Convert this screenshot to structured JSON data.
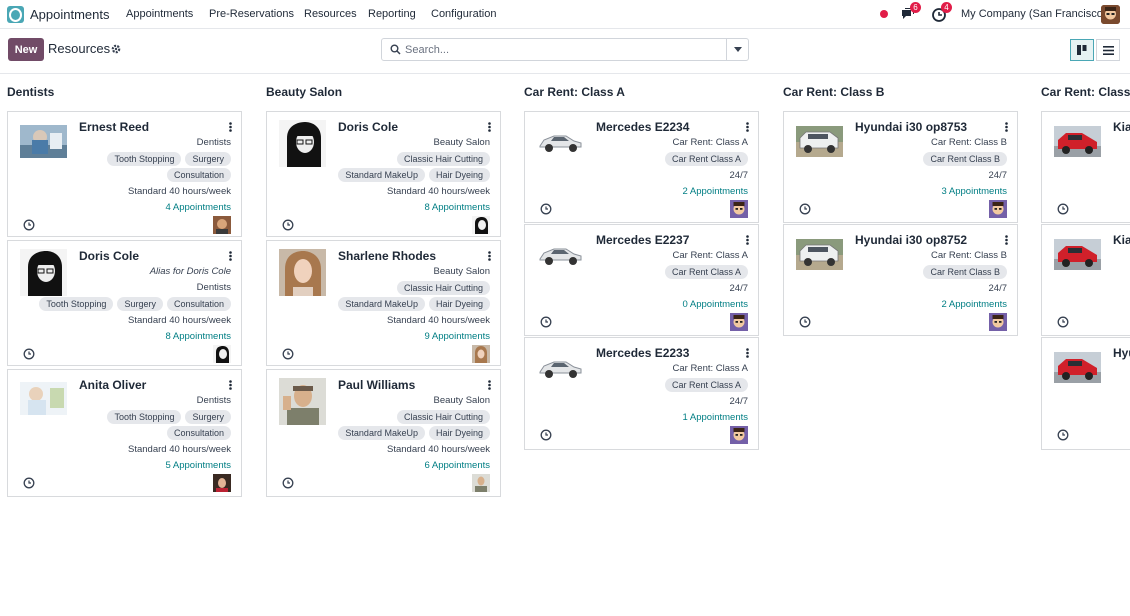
{
  "topbar": {
    "app_name": "Appointments",
    "menu": [
      "Appointments",
      "Pre-Reservations",
      "Resources",
      "Reporting",
      "Configuration"
    ],
    "messages_count": "6",
    "activities_count": "4",
    "company": "My Company (San Francisco)"
  },
  "control": {
    "new_label": "New",
    "breadcrumb": "Resources",
    "search_placeholder": "Search..."
  },
  "columns": [
    {
      "title": "Dentists",
      "cards": [
        {
          "name": "Ernest Reed",
          "lines": [
            "Dentists"
          ],
          "tag_rows": [
            [
              "Tooth Stopping",
              "Surgery"
            ],
            [
              "Consultation"
            ]
          ],
          "capacity": "Standard 40 hours/week",
          "appointments": "4 Appointments"
        },
        {
          "name": "Doris Cole",
          "alias": "Alias for Doris Cole",
          "lines": [
            "Dentists"
          ],
          "tag_rows": [
            [
              "Tooth Stopping",
              "Surgery",
              "Consultation"
            ]
          ],
          "capacity": "Standard 40 hours/week",
          "appointments": "8 Appointments"
        },
        {
          "name": "Anita Oliver",
          "lines": [
            "Dentists"
          ],
          "tag_rows": [
            [
              "Tooth Stopping",
              "Surgery"
            ],
            [
              "Consultation"
            ]
          ],
          "capacity": "Standard 40 hours/week",
          "appointments": "5 Appointments"
        }
      ]
    },
    {
      "title": "Beauty Salon",
      "cards": [
        {
          "name": "Doris Cole",
          "lines": [
            "Beauty Salon"
          ],
          "tag_rows": [
            [
              "Classic Hair Cutting"
            ],
            [
              "Standard MakeUp",
              "Hair Dyeing"
            ]
          ],
          "capacity": "Standard 40 hours/week",
          "appointments": "8 Appointments"
        },
        {
          "name": "Sharlene Rhodes",
          "lines": [
            "Beauty Salon"
          ],
          "tag_rows": [
            [
              "Classic Hair Cutting"
            ],
            [
              "Standard MakeUp",
              "Hair Dyeing"
            ]
          ],
          "capacity": "Standard 40 hours/week",
          "appointments": "9 Appointments"
        },
        {
          "name": "Paul Williams",
          "lines": [
            "Beauty Salon"
          ],
          "tag_rows": [
            [
              "Classic Hair Cutting"
            ],
            [
              "Standard MakeUp",
              "Hair Dyeing"
            ]
          ],
          "capacity": "Standard 40 hours/week",
          "appointments": "6 Appointments"
        }
      ]
    },
    {
      "title": "Car Rent: Class A",
      "cards": [
        {
          "name": "Mercedes E2234",
          "lines": [
            "Car Rent: Class A"
          ],
          "tag_rows": [
            [
              "Car Rent Class A"
            ]
          ],
          "capacity": "24/7",
          "appointments": "2 Appointments"
        },
        {
          "name": "Mercedes E2237",
          "lines": [
            "Car Rent: Class A"
          ],
          "tag_rows": [
            [
              "Car Rent Class A"
            ]
          ],
          "capacity": "24/7",
          "appointments": "0 Appointments"
        },
        {
          "name": "Mercedes E2233",
          "lines": [
            "Car Rent: Class A"
          ],
          "tag_rows": [
            [
              "Car Rent Class A"
            ]
          ],
          "capacity": "24/7",
          "appointments": "1 Appointments"
        }
      ]
    },
    {
      "title": "Car Rent: Class B",
      "cards": [
        {
          "name": "Hyundai i30 op8753",
          "lines": [
            "Car Rent: Class B"
          ],
          "tag_rows": [
            [
              "Car Rent Class B"
            ]
          ],
          "capacity": "24/7",
          "appointments": "3 Appointments"
        },
        {
          "name": "Hyundai i30 op8752",
          "lines": [
            "Car Rent: Class B"
          ],
          "tag_rows": [
            [
              "Car Rent Class B"
            ]
          ],
          "capacity": "24/7",
          "appointments": "2 Appointments"
        }
      ]
    },
    {
      "title": "Car Rent: Class C",
      "cards": [
        {
          "name": "Kia",
          "lines": [],
          "tag_rows": [],
          "capacity": "",
          "appointments": ""
        },
        {
          "name": "Kia",
          "lines": [],
          "tag_rows": [],
          "capacity": "",
          "appointments": ""
        },
        {
          "name": "Hyu",
          "lines": [],
          "tag_rows": [],
          "capacity": "",
          "appointments": ""
        }
      ]
    }
  ],
  "colors": {
    "brand": "#714b67",
    "accent": "#017e84",
    "tag_bg": "#e5e7eb",
    "badge": "#e11d48"
  }
}
